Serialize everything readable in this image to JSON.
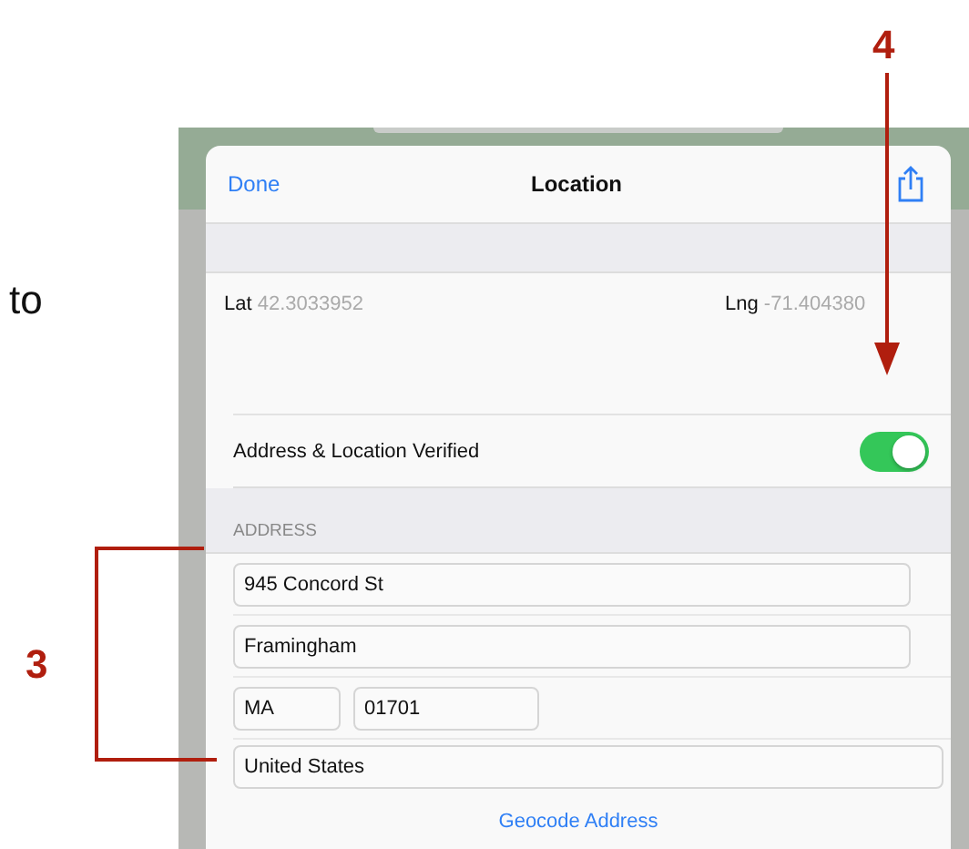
{
  "page_text": "to",
  "callouts": [
    {
      "label": "4",
      "kind": "arrow"
    },
    {
      "label": "3",
      "kind": "bracket"
    }
  ],
  "sheet": {
    "nav": {
      "done": "Done",
      "title": "Location"
    },
    "coords": {
      "lat_label": "Lat",
      "lat_value": "42.3033952",
      "lng_label": "Lng",
      "lng_value": "-71.404380"
    },
    "verified": {
      "label": "Address & Location Verified",
      "on": true
    },
    "address": {
      "header": "ADDRESS",
      "street": "945 Concord St",
      "city": "Framingham",
      "state": "MA",
      "zip": "01701",
      "country": "United States",
      "action": "Geocode Address"
    }
  }
}
